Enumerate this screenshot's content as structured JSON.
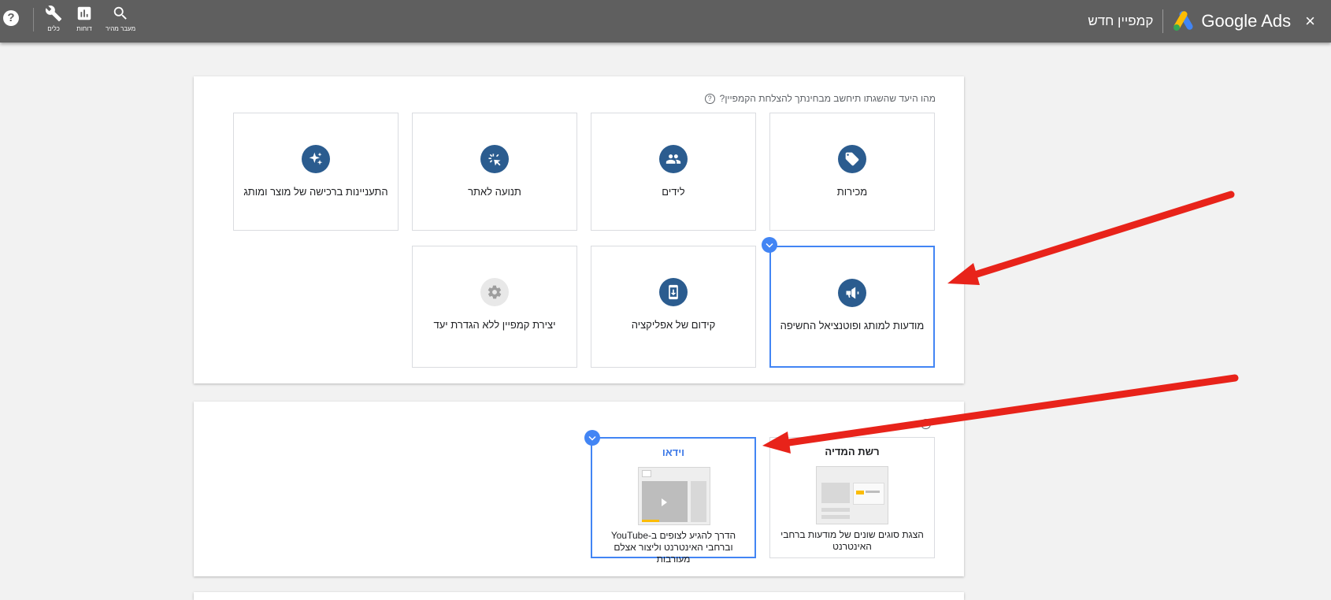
{
  "topbar": {
    "title": "קמפיין חדש",
    "logo_text": "Google Ads",
    "close_label": "×",
    "help_label": "?",
    "tools": [
      {
        "label": "מעבר מהיר",
        "icon": "search-icon"
      },
      {
        "label": "דוחות",
        "icon": "bar-chart-icon"
      },
      {
        "label": "כלים",
        "icon": "wrench-icon"
      }
    ]
  },
  "goals": {
    "question": "מהו היעד שהשגתו תיחשב מבחינתך להצלחת הקמפיין?",
    "tiles": [
      {
        "label": "מכירות",
        "icon": "tag-icon"
      },
      {
        "label": "לידים",
        "icon": "people-icon"
      },
      {
        "label": "תנועה לאתר",
        "icon": "cursor-click-icon"
      },
      {
        "label": "התעניינות ברכישה של מוצר ומותג",
        "icon": "sparkle-icon"
      },
      {
        "label": "מודעות למותג ופוטנציאל החשיפה",
        "icon": "megaphone-icon",
        "selected": true
      },
      {
        "label": "קידום של אפליקציה",
        "icon": "phone-download-icon"
      },
      {
        "label": "יצירת קמפיין ללא הגדרת יעד",
        "icon": "gear-icon"
      }
    ]
  },
  "campaign_type": {
    "tiles": [
      {
        "title": "רשת המדיה",
        "description": "הצגת סוגים שונים של מודעות ברחבי האינטרנט",
        "icon": "display-network-illustration"
      },
      {
        "title": "וידאו",
        "description": "הדרך להגיע לצופים ב-YouTube וברחבי האינטרנט וליצור אצלם מעורבות",
        "icon": "video-illustration",
        "selected": true
      }
    ]
  },
  "colors": {
    "topbar": "#5f5f5f",
    "icon_circle": "#2b5c8f",
    "selected_border": "#4285f4",
    "arrow": "#e8231a"
  }
}
